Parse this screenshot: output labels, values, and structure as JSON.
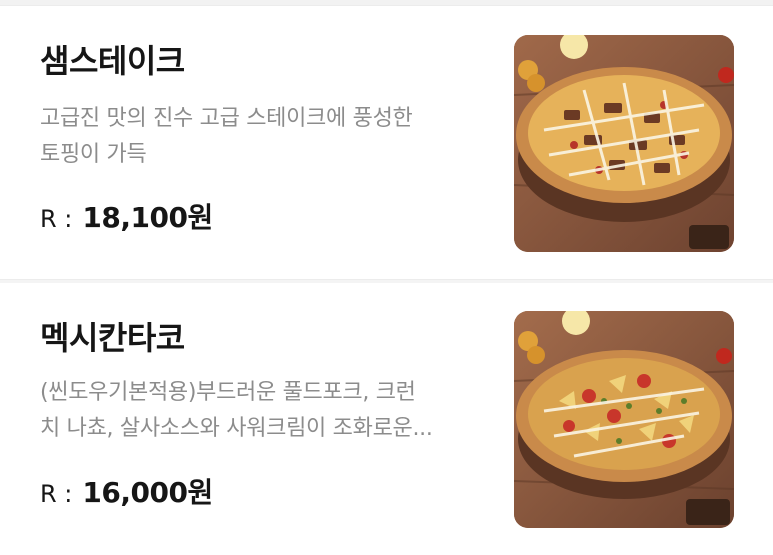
{
  "menu": [
    {
      "name": "샘스테이크",
      "description_line1": "고급진 맛의 진수 고급 스테이크에 풍성한",
      "description_line2": "토핑이 가득",
      "price_label": "R :",
      "price": "18,100원",
      "image_icon": "pizza-steak-image"
    },
    {
      "name": "멕시칸타코",
      "description_line1": "(씬도우기본적용)부드러운 풀드포크, 크런",
      "description_line2": "치 나쵸, 살사소스와 사워크림이 조화로운...",
      "price_label": "R :",
      "price": "16,000원",
      "image_icon": "pizza-taco-image"
    }
  ]
}
